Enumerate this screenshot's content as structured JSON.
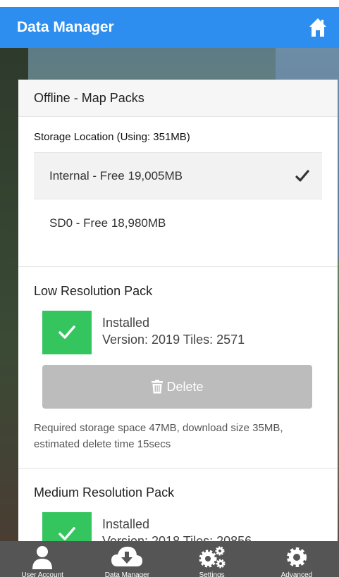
{
  "header": {
    "title": "Data Manager",
    "home_icon": "home-icon"
  },
  "card": {
    "title": "Offline - Map Packs",
    "storage_label": "Storage Location (Using: 351MB)",
    "locations": [
      {
        "label": "Internal - Free 19,005MB",
        "selected": true
      },
      {
        "label": "SD0 - Free 18,980MB",
        "selected": false
      }
    ],
    "packs": [
      {
        "title": "Low Resolution Pack",
        "status": "Installed",
        "version_line": "Version: 2019 Tiles: 2571",
        "delete_label": "Delete",
        "note": "Required storage space 47MB, download size 35MB, estimated delete time 15secs"
      },
      {
        "title": "Medium Resolution Pack",
        "status": "Installed",
        "version_line": "Version: 2018 Tiles: 20856"
      }
    ]
  },
  "bottom_nav": [
    {
      "label": "User Account",
      "icon": "user-icon"
    },
    {
      "label": "Data Manager",
      "icon": "cloud-download-icon"
    },
    {
      "label": "Settings",
      "icon": "gears-icon"
    },
    {
      "label": "Advanced",
      "icon": "gear-icon"
    }
  ],
  "colors": {
    "header": "#2d8ef0",
    "check": "#35c55e",
    "delete_disabled": "#bcbcbc",
    "nav": "#555555"
  }
}
